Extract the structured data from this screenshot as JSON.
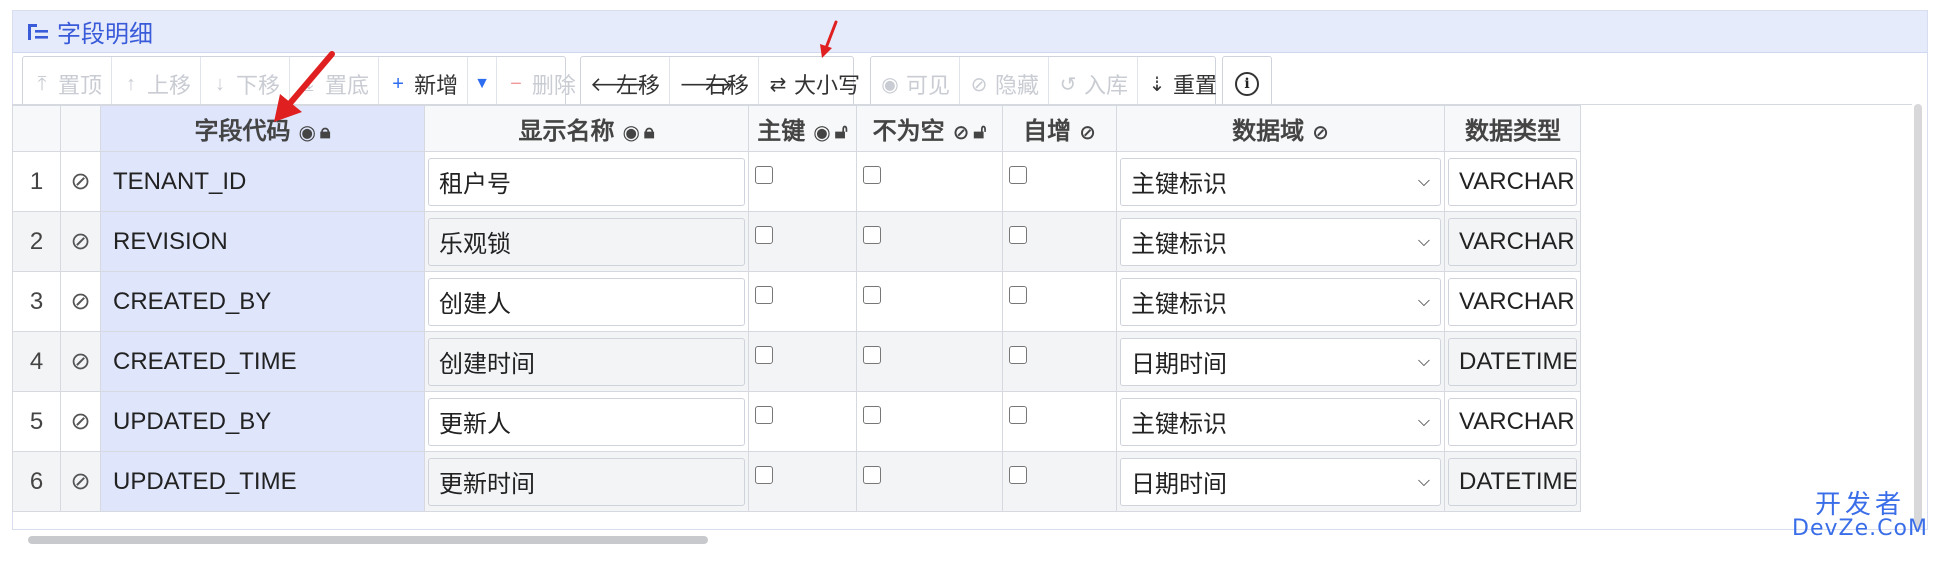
{
  "panel": {
    "title": "字段明细"
  },
  "toolbar": {
    "group1": [
      {
        "icon": "arrow-top",
        "label": "置顶",
        "disabled": true
      },
      {
        "icon": "arrow-up",
        "label": "上移",
        "disabled": true
      },
      {
        "icon": "arrow-down",
        "label": "下移",
        "disabled": true
      },
      {
        "icon": "arrow-bottom",
        "label": "置底",
        "disabled": true
      },
      {
        "icon": "plus",
        "label": "新增",
        "disabled": false
      },
      {
        "icon": "caret-down",
        "label": "",
        "disabled": false
      },
      {
        "icon": "minus",
        "label": "删除",
        "disabled": true
      }
    ],
    "group2": [
      {
        "icon": "arrow-left",
        "label": "左移"
      },
      {
        "icon": "arrow-right",
        "label": "右移"
      },
      {
        "icon": "swap",
        "label": "大小写"
      }
    ],
    "group3": [
      {
        "icon": "eye",
        "label": "可见",
        "disabled": true
      },
      {
        "icon": "eye-slash",
        "label": "隐藏",
        "disabled": true
      },
      {
        "icon": "db-in",
        "label": "入库",
        "disabled": true
      },
      {
        "icon": "sort",
        "label": "重置",
        "disabled": false
      }
    ]
  },
  "columns": {
    "code": "字段代码",
    "display": "显示名称",
    "pk": "主键",
    "notnull": "不为空",
    "autoinc": "自增",
    "domain": "数据域",
    "dtype": "数据类型"
  },
  "rows": [
    {
      "n": "1",
      "code": "TENANT_ID",
      "display": "租户号",
      "domain": "主键标识",
      "dtype": "VARCHAR"
    },
    {
      "n": "2",
      "code": "REVISION",
      "display": "乐观锁",
      "domain": "主键标识",
      "dtype": "VARCHAR"
    },
    {
      "n": "3",
      "code": "CREATED_BY",
      "display": "创建人",
      "domain": "主键标识",
      "dtype": "VARCHAR"
    },
    {
      "n": "4",
      "code": "CREATED_TIME",
      "display": "创建时间",
      "domain": "日期时间",
      "dtype": "DATETIME"
    },
    {
      "n": "5",
      "code": "UPDATED_BY",
      "display": "更新人",
      "domain": "主键标识",
      "dtype": "VARCHAR"
    },
    {
      "n": "6",
      "code": "UPDATED_TIME",
      "display": "更新时间",
      "domain": "日期时间",
      "dtype": "DATETIME"
    }
  ],
  "watermark": {
    "line1": "开发者",
    "line2": "DevZe.CoM"
  },
  "colors": {
    "accent": "#3a5bd9",
    "annotation": "#e02020",
    "highlight_column": "#dfe5fb"
  }
}
